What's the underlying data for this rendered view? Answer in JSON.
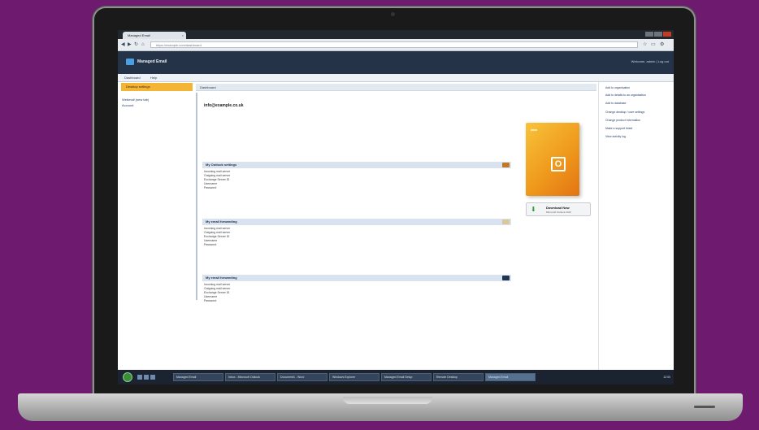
{
  "browser": {
    "tab_title": "Managed Email",
    "tab_close": "×",
    "url": "https://example.com/dashboard",
    "nav": {
      "back": "◀",
      "forward": "▶",
      "reload": "↻",
      "home": "⌂"
    },
    "tools": {
      "star": "☆",
      "page": "▭",
      "wrench": "⚙"
    }
  },
  "header": {
    "app_name": "Managed Email",
    "user_text": "Welcome, admin | Log out"
  },
  "menubar": {
    "items": [
      "Dashboard",
      "Help"
    ]
  },
  "leftnav": {
    "active_label": "Desktop settings",
    "links": [
      "Webmail (new tab)",
      "Account"
    ]
  },
  "main": {
    "title_bar": "Dashboard",
    "email": "info@example.co.uk",
    "sections": [
      {
        "title": "My Outlook settings",
        "icon_color": "#c0782a",
        "rows": [
          "Incoming mail server",
          "Outgoing mail server",
          "Exchange Server ID",
          "Username",
          "Password"
        ]
      },
      {
        "title": "My email forwarding",
        "icon_color": "#d9c89a",
        "rows": [
          "Incoming mail server",
          "Outgoing mail server",
          "Exchange Server ID",
          "Username",
          "Password"
        ]
      },
      {
        "title": "My email forwarding",
        "icon_color": "#1f3552",
        "rows": [
          "Incoming mail server",
          "Outgoing mail server",
          "Exchange Server ID",
          "Username",
          "Password"
        ]
      }
    ],
    "download": {
      "label": "Download Now",
      "sub": "Microsoft Outlook 2010"
    },
    "product_mark": "O"
  },
  "rightmenu": {
    "items": [
      "Add to organisation",
      "Add to details to an organisation",
      "Add to database",
      "Change desktop / user settings",
      "Change product information",
      "Make a support ticket",
      "View activity log"
    ]
  },
  "taskbar": {
    "items": [
      "Managed Email",
      "Inbox - Microsoft Outlook",
      "Document1 - Word",
      "Windows Explorer",
      "Managed Email Setup",
      "Remote Desktop",
      "Managed Email"
    ],
    "tray": "12:00"
  }
}
